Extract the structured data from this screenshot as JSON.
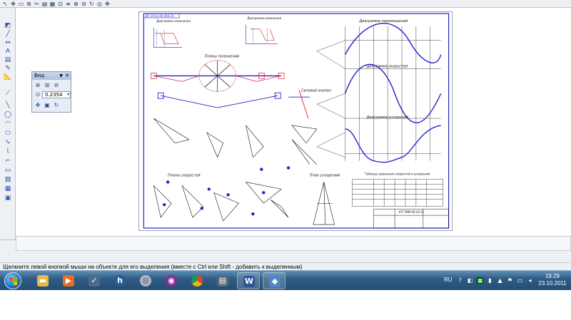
{
  "toolbar_top": {
    "icons": [
      "pointer-icon",
      "pan-icon",
      "select-icon",
      "copy-icon",
      "cut-icon",
      "paste-icon",
      "grid-icon",
      "snap-icon",
      "layers-icon",
      "zoom-in-icon",
      "zoom-out-icon",
      "refresh-icon",
      "fit-icon"
    ]
  },
  "toolbar_left": {
    "icons": [
      "geometry-icon",
      "line-icon",
      "circle-icon",
      "arc-icon",
      "dimension-icon",
      "hatch-icon",
      "text-icon",
      "table-icon",
      "spec-icon",
      "edit-icon",
      "measure-icon",
      "view-icon",
      "param-icon",
      "selection-icon",
      "library-icon"
    ]
  },
  "view_panel": {
    "title": "Вид",
    "scale_value": "0.2354"
  },
  "drawing": {
    "stamp_top_left": "ДП 19.03.00.000 ЭЗ",
    "section_plans_positions": "Планы положений",
    "section_velocity_plans": "Планы скоростей",
    "section_acceleration_plan": "План ускорений",
    "section_force_analysis": "Силовой анализ",
    "diagram_displacements": "Диаграмма перемещений",
    "diagram_velocities": "Диаграмма скоростей",
    "diagram_accelerations": "Диаграмма ускорений",
    "diagram_work_1": "Диаграмма изменения",
    "diagram_work_2": "Диаграмма изменения",
    "table_title": "Таблица сравнения скоростей и ускорений",
    "title_block_code": "КП ТММ 09.05.01"
  },
  "status": {
    "hint": "Щелкните левой кнопкой мыши на объекте для его выделения (вместе с Ctrl или Shift - добавить к выделенным)"
  },
  "taskbar": {
    "apps": [
      "explorer-icon",
      "media-player-icon",
      "task-icon",
      "hp-icon",
      "disc-icon",
      "app-icon",
      "chrome-icon",
      "printer-icon",
      "word-icon",
      "kompas-icon"
    ],
    "lang": "RU",
    "time": "19:29",
    "date": "23.10.2011"
  },
  "colors": {
    "drawing_blue": "#2222cc",
    "drawing_red": "#cc2222",
    "drawing_black": "#111111",
    "taskbar": "#2f5d86"
  }
}
